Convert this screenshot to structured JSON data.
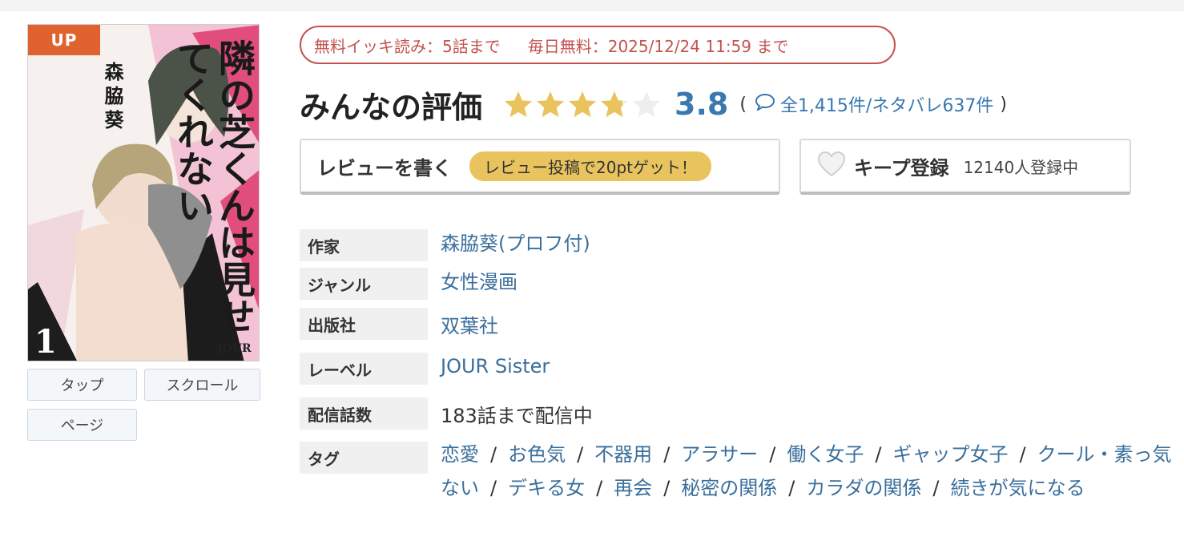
{
  "cover": {
    "badge": "UP",
    "title_text": "隣の芝くんは見せてくれない",
    "author_text": "森脇葵",
    "volume": "1",
    "label_mark": "JOUR"
  },
  "view_buttons": [
    "タップ",
    "スクロール",
    "ページ"
  ],
  "free_banner": {
    "part1": "無料イッキ読み：5話まで",
    "part2": "毎日無料：2025/12/24 11:59 まで"
  },
  "rating": {
    "title": "みんなの評価",
    "score": "3.8",
    "stars_filled": 3.8,
    "stars_total": 5,
    "paren_open": "(",
    "counts_text": "全1,415件/ネタバレ637件",
    "paren_close": ")"
  },
  "actions": {
    "review_label": "レビューを書く",
    "review_promo": "レビュー投稿で20ptゲット！",
    "keep_label": "キープ登録",
    "keep_count": "12140人登録中"
  },
  "info": {
    "author_label": "作家",
    "author_value": "森脇葵(プロフ付)",
    "genre_label": "ジャンル",
    "genre_value": "女性漫画",
    "publisher_label": "出版社",
    "publisher_value": "双葉社",
    "label_label": "レーベル",
    "label_value": "JOUR Sister",
    "episodes_label": "配信話数",
    "episodes_value": "183話まで配信中",
    "tags_label": "タグ",
    "tags": [
      "恋愛",
      "お色気",
      "不器用",
      "アラサー",
      "働く女子",
      "ギャップ女子",
      "クール・素っ気ない",
      "デキる女",
      "再会",
      "秘密の関係",
      "カラダの関係",
      "続きが気になる"
    ],
    "tag_separator": "/"
  },
  "colors": {
    "accent_link": "#3a6f9c",
    "score_blue": "#3a78b0",
    "banner_red": "#c4534f",
    "star_gold": "#e9c45e",
    "badge_orange": "#e0622f"
  }
}
